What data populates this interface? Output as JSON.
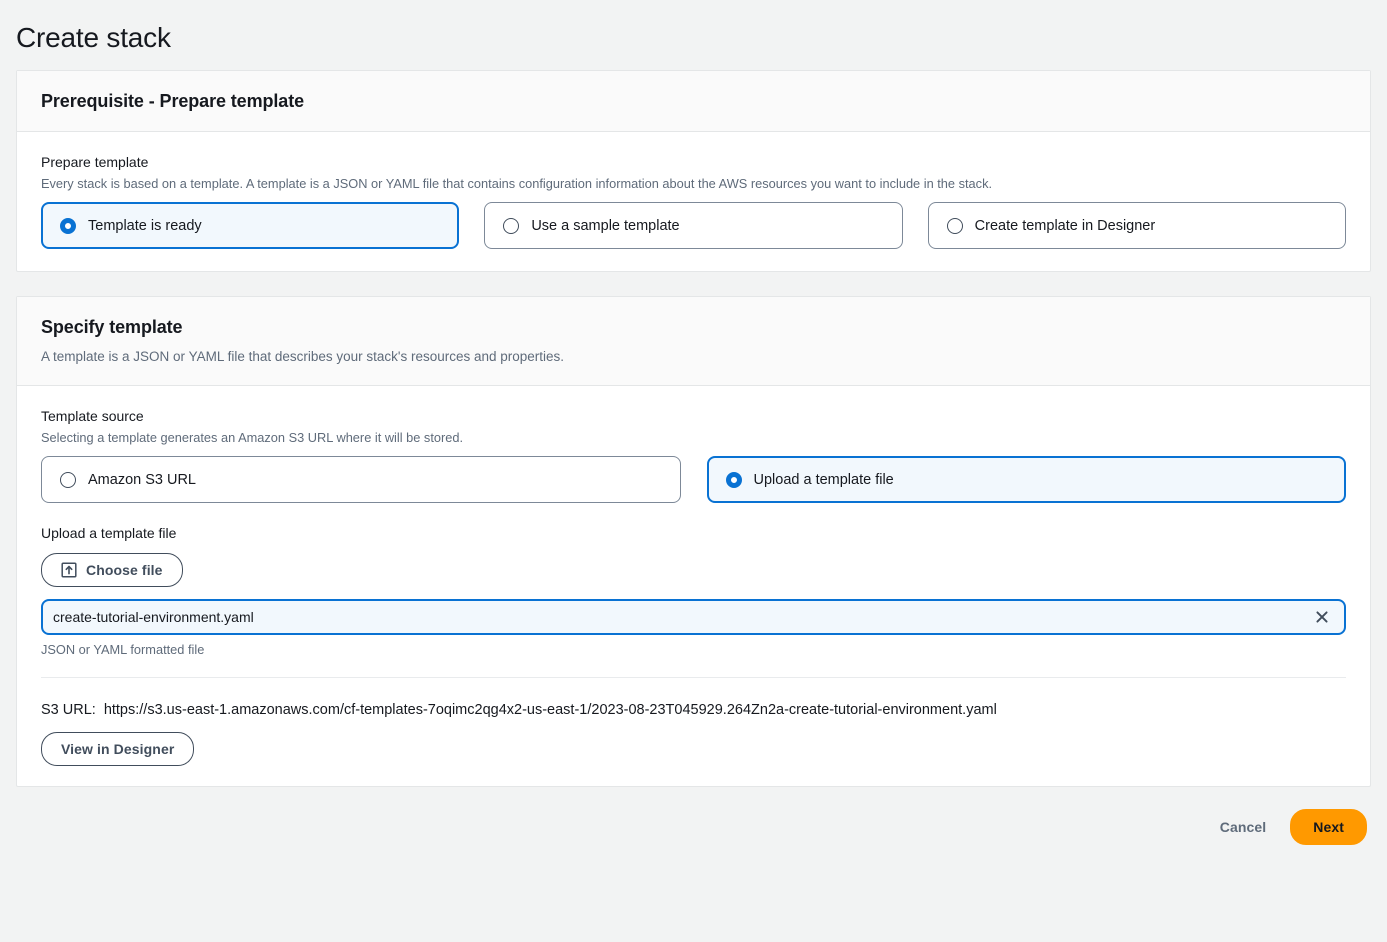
{
  "page": {
    "title": "Create stack"
  },
  "prerequisite": {
    "heading": "Prerequisite - Prepare template",
    "field_label": "Prepare template",
    "field_desc": "Every stack is based on a template. A template is a JSON or YAML file that contains configuration information about the AWS resources you want to include in the stack.",
    "options": [
      {
        "label": "Template is ready",
        "selected": true
      },
      {
        "label": "Use a sample template",
        "selected": false
      },
      {
        "label": "Create template in Designer",
        "selected": false
      }
    ]
  },
  "specify_template": {
    "heading": "Specify template",
    "subtitle": "A template is a JSON or YAML file that describes your stack's resources and properties.",
    "source_label": "Template source",
    "source_desc": "Selecting a template generates an Amazon S3 URL where it will be stored.",
    "source_options": [
      {
        "label": "Amazon S3 URL",
        "selected": false
      },
      {
        "label": "Upload a template file",
        "selected": true
      }
    ],
    "upload_label": "Upload a template file",
    "choose_file_button": "Choose file",
    "file_name": "create-tutorial-environment.yaml",
    "file_hint": "JSON or YAML formatted file",
    "s3_url_label": "S3 URL:",
    "s3_url_value": "https://s3.us-east-1.amazonaws.com/cf-templates-7oqimc2qg4x2-us-east-1/2023-08-23T045929.264Zn2a-create-tutorial-environment.yaml",
    "view_in_designer_button": "View in Designer"
  },
  "footer": {
    "cancel_label": "Cancel",
    "next_label": "Next"
  },
  "colors": {
    "accent_blue": "#0972d3",
    "aws_orange": "#ff9900",
    "page_background": "#f2f3f3",
    "card_background": "#ffffff",
    "header_background": "#fafafa",
    "border": "#e4e6e7",
    "secondary_text": "#5f6b7a"
  }
}
